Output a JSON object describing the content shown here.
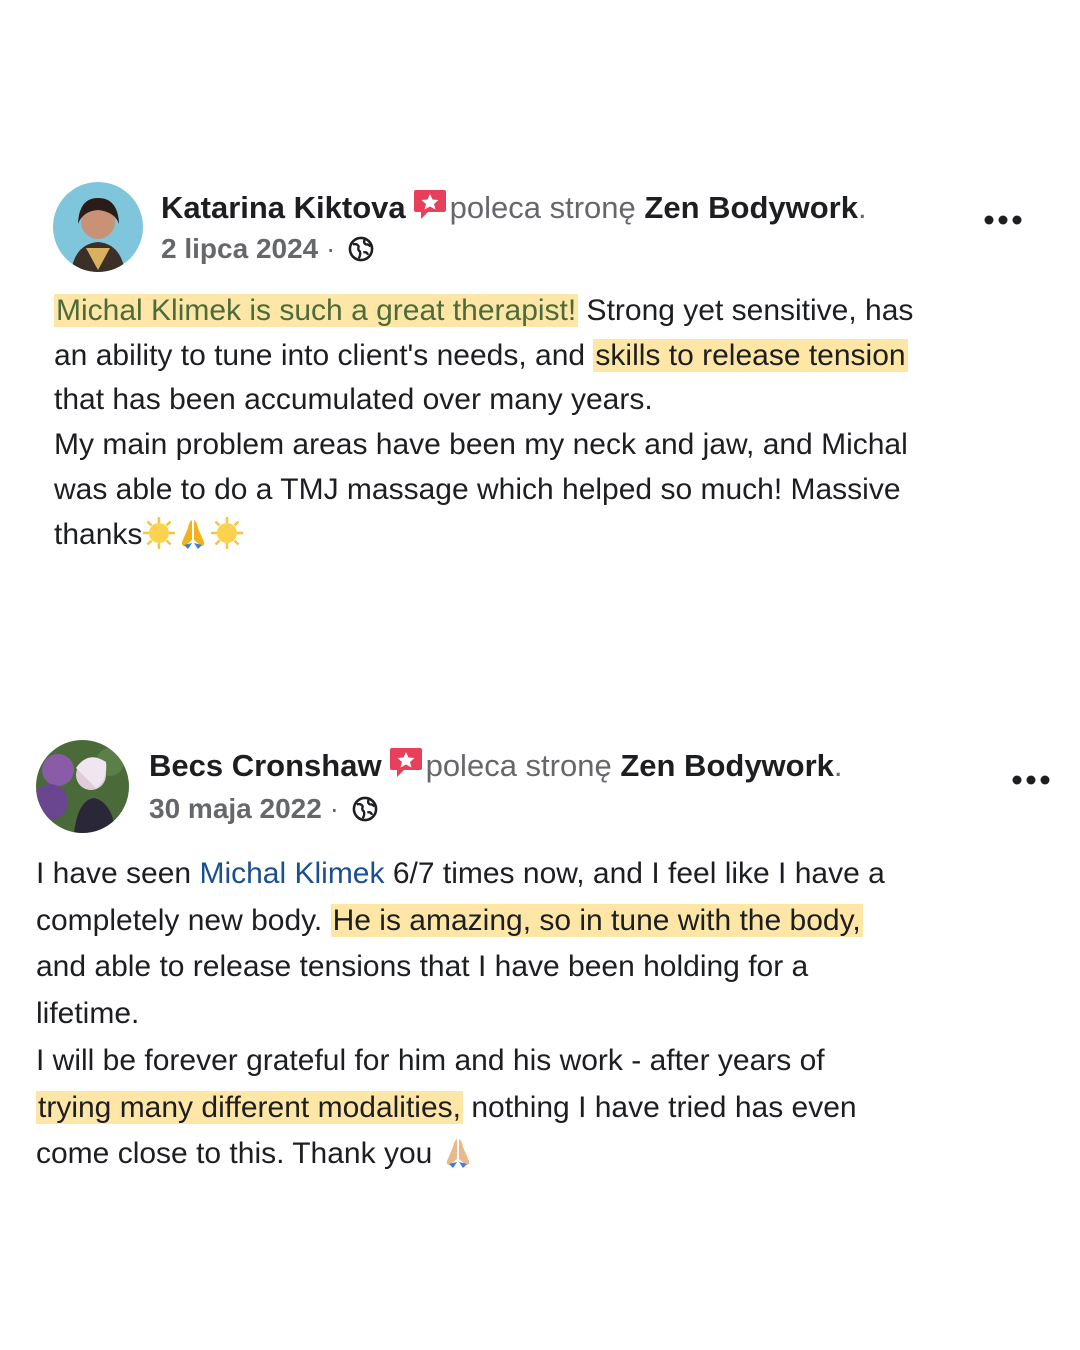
{
  "posts": [
    {
      "author": "Katarina Kiktova",
      "verb": "poleca stronę",
      "page": "Zen Bodywork",
      "date": "2 lipca 2024",
      "separator": "·",
      "privacy_icon": "globe-icon",
      "recommend_icon": "recommend-badge-icon",
      "more_icon": "more-options-icon",
      "lines": [
        {
          "highlight": "Michal Klimek is such a great therapist!",
          "rest": " Strong yet sensitive, has"
        },
        {
          "pre": "an ability to tune into client's needs, and ",
          "highlight": "skills to release tension"
        },
        {
          "text": "that has been accumulated over many years."
        },
        {
          "text": "My main problem areas have been my neck and jaw, and Michal"
        },
        {
          "text": "was able to do a TMJ massage which helped so much! Massive"
        },
        {
          "text": "thanks",
          "emojis": [
            "sun-emoji",
            "folded-hands-emoji",
            "sun-emoji"
          ]
        }
      ]
    },
    {
      "author": "Becs Cronshaw",
      "verb": "poleca stronę",
      "page": "Zen Bodywork",
      "date": "30 maja 2022",
      "separator": "·",
      "privacy_icon": "globe-icon",
      "recommend_icon": "recommend-badge-icon",
      "more_icon": "more-options-icon",
      "lines": [
        {
          "pre": "I have seen ",
          "mention": "Michal Klimek",
          "rest": " 6/7 times now, and I feel like I have a"
        },
        {
          "pre": "completely new body. ",
          "highlight": "He is amazing, so in tune with the body,"
        },
        {
          "text": "and able to release tensions that I have been holding for a"
        },
        {
          "text": "lifetime."
        },
        {
          "text": "I will be forever grateful for him and his work -  after years of"
        },
        {
          "highlight": "trying many different modalities,",
          "rest": " nothing I have tried has even"
        },
        {
          "text": "come close to this. Thank you ",
          "emojis": [
            "folded-hands-emoji"
          ]
        }
      ]
    }
  ],
  "colors": {
    "highlight": "#fde6a6",
    "mention": "#1b4f93",
    "secondary_text": "#65676b",
    "recommend_badge": "#e8405a"
  }
}
